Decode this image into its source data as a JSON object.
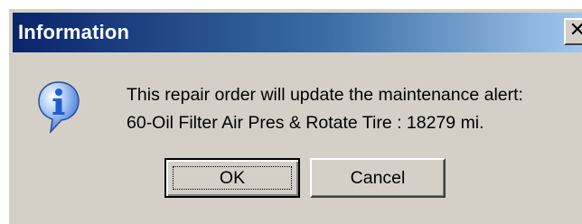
{
  "window": {
    "title": "Information",
    "close_glyph": "✕"
  },
  "icon": {
    "name": "information-icon",
    "glyph": "i",
    "color": "#1f5fd6"
  },
  "message": {
    "line1": "This repair order will update the maintenance alert:",
    "line2": "60-Oil Filter Air Pres & Rotate Tire :  18279 mi."
  },
  "buttons": {
    "ok_label": "OK",
    "cancel_label": "Cancel"
  }
}
